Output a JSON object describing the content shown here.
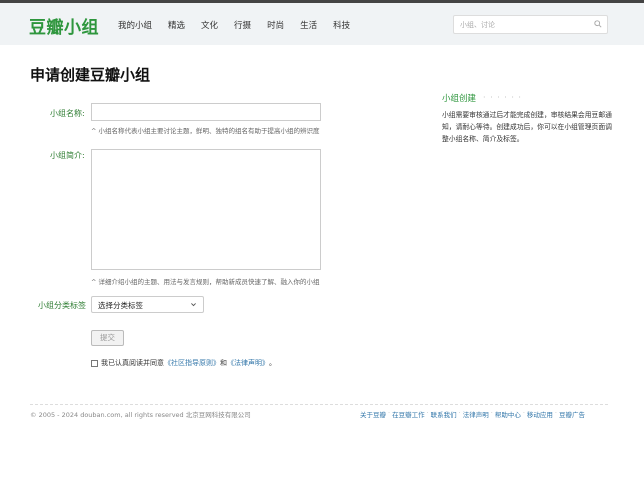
{
  "header": {
    "logo": "豆瓣小组",
    "nav": [
      "我的小组",
      "精选",
      "文化",
      "行摄",
      "时尚",
      "生活",
      "科技"
    ],
    "search_placeholder": "小组、讨论"
  },
  "page": {
    "title": "申请创建豆瓣小组"
  },
  "form": {
    "name_label": "小组名称:",
    "name_value": "",
    "name_hint": "^ 小组名称代表小组主要讨论主题，鲜明、独特的组名有助于提高小组的辨识度",
    "intro_label": "小组简介:",
    "intro_value": "",
    "intro_hint": "^ 详细介绍小组的主题、用法与发言规则，帮助新成员快速了解、融入你的小组",
    "tag_label": "小组分类标签",
    "tag_selected": "选择分类标签",
    "submit_label": "提交",
    "agree_prefix": "我已认真阅读并同意",
    "agree_link1": "《社区指导原则》",
    "agree_and": "和",
    "agree_link2": "《法律声明》",
    "agree_suffix": "。"
  },
  "sidebar": {
    "title": "小组创建",
    "dots": "· · · · · ·",
    "text": "小组需要审核通过后才能完成创建，审核结果会用豆邮通知，请耐心等待。创建成功后，你可以在小组管理页面调整小组名称、简介及标签。"
  },
  "footer": {
    "copyright": "© 2005 - 2024 douban.com, all rights reserved 北京豆网科技有限公司",
    "links": [
      "关于豆瓣",
      "在豆瓣工作",
      "联系我们",
      "法律声明",
      "帮助中心",
      "移动应用",
      "豆瓣广告"
    ],
    "separator": "·"
  },
  "colors": {
    "brand_green": "#2e963d",
    "label_green": "#2e7d32",
    "link_blue": "#3377aa",
    "header_bg": "#f0f3f5"
  }
}
